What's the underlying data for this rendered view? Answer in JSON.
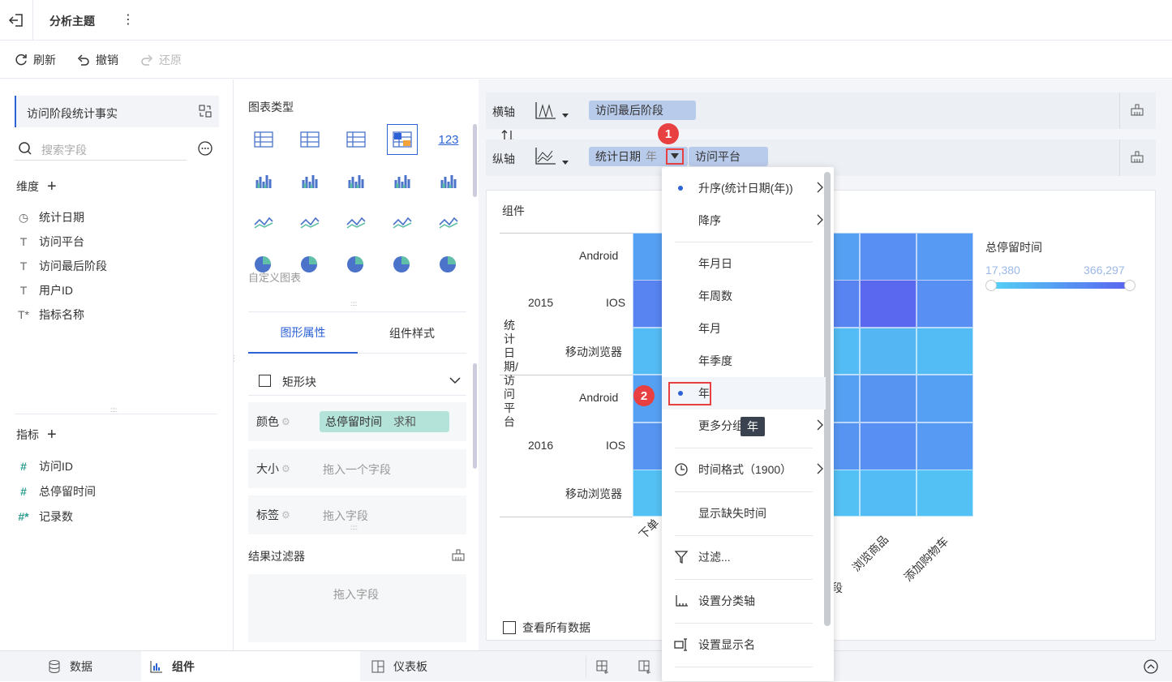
{
  "topbar": {
    "title": "分析主题",
    "more": "⋮"
  },
  "toolbar": {
    "refresh": "刷新",
    "undo": "撤销",
    "redo": "还原"
  },
  "left": {
    "table_name": "访问阶段统计事实",
    "search_placeholder": "搜索字段",
    "dimension_label": "维度",
    "dimensions": [
      {
        "icon": "clock-icon",
        "label": "统计日期"
      },
      {
        "icon": "text-icon",
        "label": "访问平台"
      },
      {
        "icon": "text-icon",
        "label": "访问最后阶段"
      },
      {
        "icon": "text-icon",
        "label": "用户ID"
      },
      {
        "icon": "text-formula-icon",
        "label": "指标名称"
      }
    ],
    "metric_label": "指标",
    "metrics": [
      {
        "icon": "hash-icon",
        "label": "访问ID"
      },
      {
        "icon": "hash-icon",
        "label": "总停留时间"
      },
      {
        "icon": "hash-formula-icon",
        "label": "记录数"
      }
    ]
  },
  "middle": {
    "chart_type_label": "图表类型",
    "custom_chart": "自定义图表",
    "tabs": [
      "图形属性",
      "组件样式"
    ],
    "shape": "矩形块",
    "color_label": "颜色",
    "color_field": "总停留时间",
    "color_agg": "求和",
    "size_label": "大小",
    "size_placeholder": "拖入一个字段",
    "label_label": "标签",
    "label_placeholder": "拖入字段",
    "filter_label": "结果过滤器",
    "filter_placeholder": "拖入字段"
  },
  "axes": {
    "x_label": "横轴",
    "x_field": "访问最后阶段",
    "y_label": "纵轴",
    "y_field1": "统计日期",
    "y_field1_suffix": "年",
    "y_field2": "访问平台"
  },
  "chart": {
    "card_title": "组件",
    "y_axis_title": "统计日期/访问平台",
    "x_axis_title_partial": "段",
    "legend_title": "总停留时间",
    "legend_min": "17,380",
    "legend_max": "366,297",
    "show_all": "查看所有数据",
    "colors": {
      "low": "#53d2f5",
      "high": "#5a62f0"
    }
  },
  "chart_data": {
    "type": "heatmap",
    "years": [
      "2015",
      "2016"
    ],
    "platforms": [
      "Android",
      "IOS",
      "移动浏览器"
    ],
    "x_categories_visible": [
      "下单",
      "浏览商品",
      "添加购物车"
    ],
    "legend_range": [
      17380,
      366297
    ]
  },
  "dropdown": {
    "items": [
      {
        "label": "升序(统计日期(年))",
        "dot": true,
        "arrow": true
      },
      {
        "label": "降序",
        "arrow": true
      },
      {
        "label": "年月日"
      },
      {
        "label": "年周数"
      },
      {
        "label": "年月"
      },
      {
        "label": "年季度"
      },
      {
        "label": "年",
        "dot": true
      },
      {
        "label": "更多分组",
        "arrow": true
      },
      {
        "label": "时间格式（1900）",
        "arrow": true
      },
      {
        "label": "显示缺失时间"
      },
      {
        "label": "过滤..."
      },
      {
        "label": "设置分类轴"
      },
      {
        "label": "设置显示名"
      }
    ],
    "tooltip": "年"
  },
  "badges": [
    "1",
    "2"
  ],
  "bottom": {
    "tabs": [
      "数据",
      "组件",
      "仪表板"
    ]
  }
}
